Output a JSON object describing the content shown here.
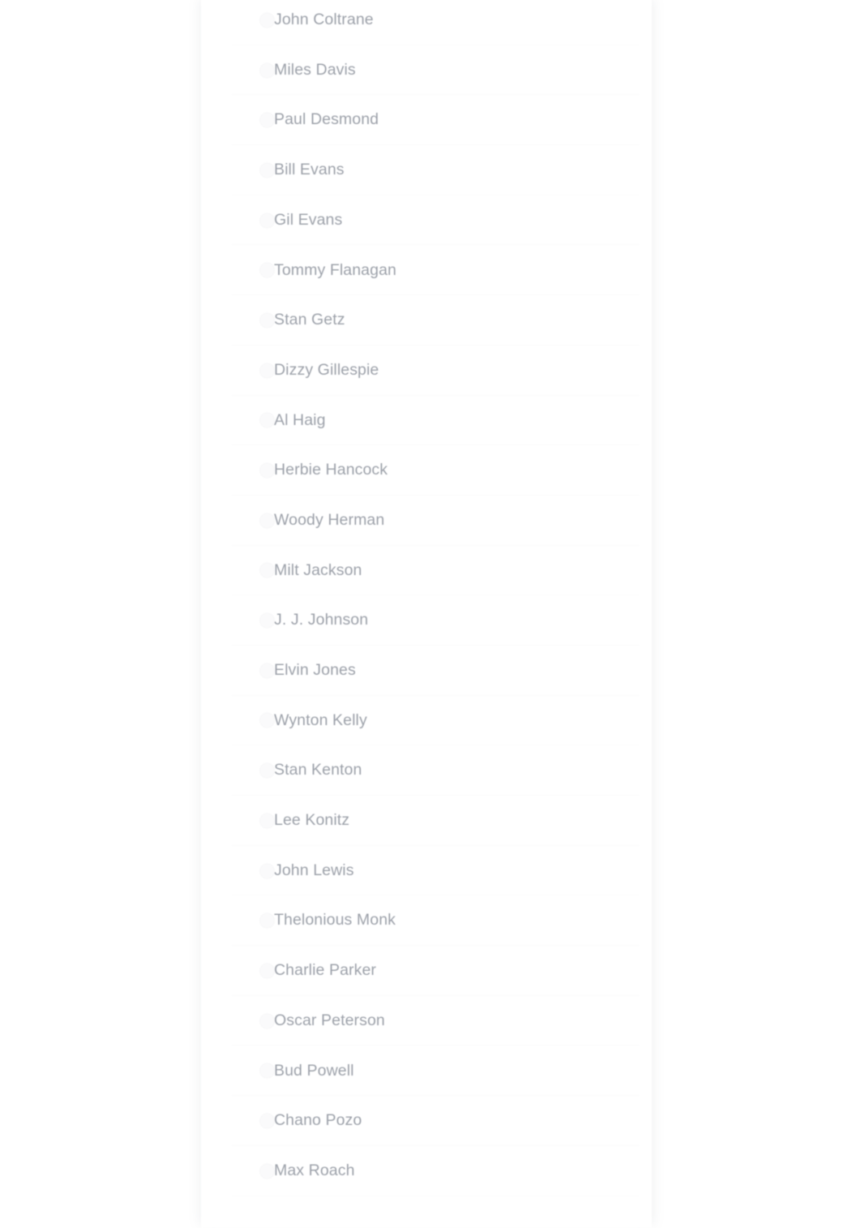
{
  "app": {
    "background_color": "#ffffff",
    "panel_background_color": "#ffffff",
    "text_color": "#959aa3",
    "separator_color": "#fbfbfc",
    "radio_color": "#fafafb"
  },
  "list": {
    "name": "jazz-musicians-list",
    "selection_type": "radio",
    "selected_index": null,
    "items": [
      {
        "label": "John Coltrane",
        "icon": "radio-unchecked-icon",
        "selected": false
      },
      {
        "label": "Miles Davis",
        "icon": "radio-unchecked-icon",
        "selected": false
      },
      {
        "label": "Paul Desmond",
        "icon": "radio-unchecked-icon",
        "selected": false
      },
      {
        "label": "Bill Evans",
        "icon": "radio-unchecked-icon",
        "selected": false
      },
      {
        "label": "Gil Evans",
        "icon": "radio-unchecked-icon",
        "selected": false
      },
      {
        "label": "Tommy Flanagan",
        "icon": "radio-unchecked-icon",
        "selected": false
      },
      {
        "label": "Stan Getz",
        "icon": "radio-unchecked-icon",
        "selected": false
      },
      {
        "label": "Dizzy Gillespie",
        "icon": "radio-unchecked-icon",
        "selected": false
      },
      {
        "label": "Al Haig",
        "icon": "radio-unchecked-icon",
        "selected": false
      },
      {
        "label": "Herbie Hancock",
        "icon": "radio-unchecked-icon",
        "selected": false
      },
      {
        "label": "Woody Herman",
        "icon": "radio-unchecked-icon",
        "selected": false
      },
      {
        "label": "Milt Jackson",
        "icon": "radio-unchecked-icon",
        "selected": false
      },
      {
        "label": "J. J. Johnson",
        "icon": "radio-unchecked-icon",
        "selected": false
      },
      {
        "label": "Elvin Jones",
        "icon": "radio-unchecked-icon",
        "selected": false
      },
      {
        "label": "Wynton Kelly",
        "icon": "radio-unchecked-icon",
        "selected": false
      },
      {
        "label": "Stan Kenton",
        "icon": "radio-unchecked-icon",
        "selected": false
      },
      {
        "label": "Lee Konitz",
        "icon": "radio-unchecked-icon",
        "selected": false
      },
      {
        "label": "John Lewis",
        "icon": "radio-unchecked-icon",
        "selected": false
      },
      {
        "label": "Thelonious Monk",
        "icon": "radio-unchecked-icon",
        "selected": false
      },
      {
        "label": "Charlie Parker",
        "icon": "radio-unchecked-icon",
        "selected": false
      },
      {
        "label": "Oscar Peterson",
        "icon": "radio-unchecked-icon",
        "selected": false
      },
      {
        "label": "Bud Powell",
        "icon": "radio-unchecked-icon",
        "selected": false
      },
      {
        "label": "Chano Pozo",
        "icon": "radio-unchecked-icon",
        "selected": false
      },
      {
        "label": "Max Roach",
        "icon": "radio-unchecked-icon",
        "selected": false
      }
    ]
  }
}
